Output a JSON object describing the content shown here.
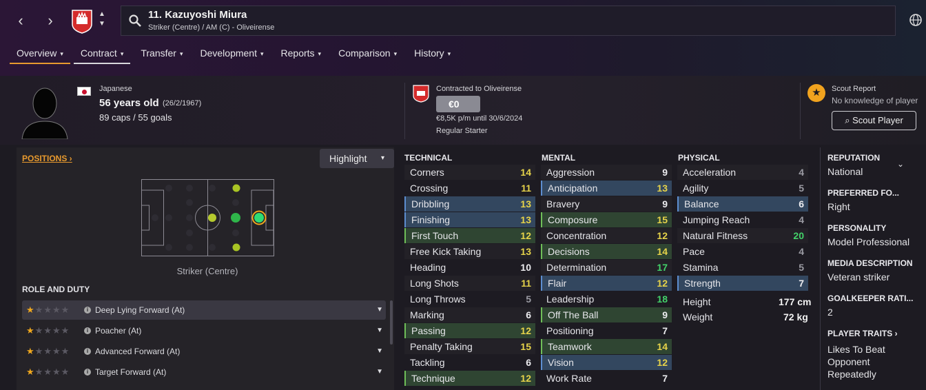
{
  "colors": {
    "accent": "#e89a2e",
    "blue_highlight": "#33475f",
    "green_highlight": "#2f4532",
    "value_yellow": "#e6d34a",
    "value_green": "#43d36a",
    "value_grey": "#9a9aa2"
  },
  "nav": {
    "back_icon": "chevron-left-icon",
    "forward_icon": "chevron-right-icon"
  },
  "player": {
    "title": "11. Kazuyoshi Miura",
    "subtitle": "Striker (Centre) / AM (C) - Oliveirense",
    "nationality": "Japanese",
    "age": "56 years old",
    "dob": "(26/2/1967)",
    "caps": "89 caps / 55 goals"
  },
  "tabs": [
    "Overview",
    "Contract",
    "Transfer",
    "Development",
    "Reports",
    "Comparison",
    "History"
  ],
  "contract": {
    "label": "Contracted to Oliveirense",
    "value": "€0",
    "wage": "€8,5K p/m until 30/6/2024",
    "status": "Regular Starter"
  },
  "scout": {
    "label": "Scout Report",
    "text": "No knowledge of player",
    "button": "Scout Player"
  },
  "positions": {
    "link": "POSITIONS ›",
    "highlight": "Highlight",
    "selected": "Striker (Centre)"
  },
  "roles": {
    "heading": "ROLE AND DUTY",
    "items": [
      {
        "name": "Deep Lying Forward (At)",
        "stars": 1.0
      },
      {
        "name": "Poacher (At)",
        "stars": 1.0
      },
      {
        "name": "Advanced Forward (At)",
        "stars": 0.5
      },
      {
        "name": "Target Forward (At)",
        "stars": 0.5
      }
    ]
  },
  "technical": {
    "heading": "TECHNICAL",
    "items": [
      {
        "name": "Corners",
        "value": "14",
        "hl": "plain"
      },
      {
        "name": "Crossing",
        "value": "11",
        "hl": "none"
      },
      {
        "name": "Dribbling",
        "value": "13",
        "hl": "blue"
      },
      {
        "name": "Finishing",
        "value": "13",
        "hl": "blue"
      },
      {
        "name": "First Touch",
        "value": "12",
        "hl": "green"
      },
      {
        "name": "Free Kick Taking",
        "value": "13",
        "hl": "plain"
      },
      {
        "name": "Heading",
        "value": "10",
        "hl": "none"
      },
      {
        "name": "Long Shots",
        "value": "11",
        "hl": "plain"
      },
      {
        "name": "Long Throws",
        "value": "5",
        "hl": "none"
      },
      {
        "name": "Marking",
        "value": "6",
        "hl": "plain"
      },
      {
        "name": "Passing",
        "value": "12",
        "hl": "green"
      },
      {
        "name": "Penalty Taking",
        "value": "15",
        "hl": "plain"
      },
      {
        "name": "Tackling",
        "value": "6",
        "hl": "none"
      },
      {
        "name": "Technique",
        "value": "12",
        "hl": "green"
      }
    ]
  },
  "mental": {
    "heading": "MENTAL",
    "items": [
      {
        "name": "Aggression",
        "value": "9",
        "hl": "plain"
      },
      {
        "name": "Anticipation",
        "value": "13",
        "hl": "blue"
      },
      {
        "name": "Bravery",
        "value": "9",
        "hl": "plain"
      },
      {
        "name": "Composure",
        "value": "15",
        "hl": "green"
      },
      {
        "name": "Concentration",
        "value": "12",
        "hl": "plain"
      },
      {
        "name": "Decisions",
        "value": "14",
        "hl": "green"
      },
      {
        "name": "Determination",
        "value": "17",
        "hl": "plain"
      },
      {
        "name": "Flair",
        "value": "12",
        "hl": "blue"
      },
      {
        "name": "Leadership",
        "value": "18",
        "hl": "none"
      },
      {
        "name": "Off The Ball",
        "value": "9",
        "hl": "green"
      },
      {
        "name": "Positioning",
        "value": "7",
        "hl": "none"
      },
      {
        "name": "Teamwork",
        "value": "14",
        "hl": "green"
      },
      {
        "name": "Vision",
        "value": "12",
        "hl": "blue"
      },
      {
        "name": "Work Rate",
        "value": "7",
        "hl": "none"
      }
    ]
  },
  "physical": {
    "heading": "PHYSICAL",
    "items": [
      {
        "name": "Acceleration",
        "value": "4",
        "hl": "plain"
      },
      {
        "name": "Agility",
        "value": "5",
        "hl": "none"
      },
      {
        "name": "Balance",
        "value": "6",
        "hl": "blue"
      },
      {
        "name": "Jumping Reach",
        "value": "4",
        "hl": "none"
      },
      {
        "name": "Natural Fitness",
        "value": "20",
        "hl": "plain"
      },
      {
        "name": "Pace",
        "value": "4",
        "hl": "none"
      },
      {
        "name": "Stamina",
        "value": "5",
        "hl": "none"
      },
      {
        "name": "Strength",
        "value": "7",
        "hl": "blue"
      }
    ],
    "height_label": "Height",
    "height": "177 cm",
    "weight_label": "Weight",
    "weight": "72 kg"
  },
  "info": [
    {
      "h": "REPUTATION",
      "v": "National"
    },
    {
      "h": "PREFERRED FO...",
      "v": "Right"
    },
    {
      "h": "PERSONALITY",
      "v": "Model Professional"
    },
    {
      "h": "MEDIA DESCRIPTION",
      "v": "Veteran striker"
    },
    {
      "h": "GOALKEEPER RATI...",
      "v": "2"
    },
    {
      "h": "PLAYER TRAITS ›",
      "v": "Likes To Beat Opponent Repeatedly"
    }
  ]
}
